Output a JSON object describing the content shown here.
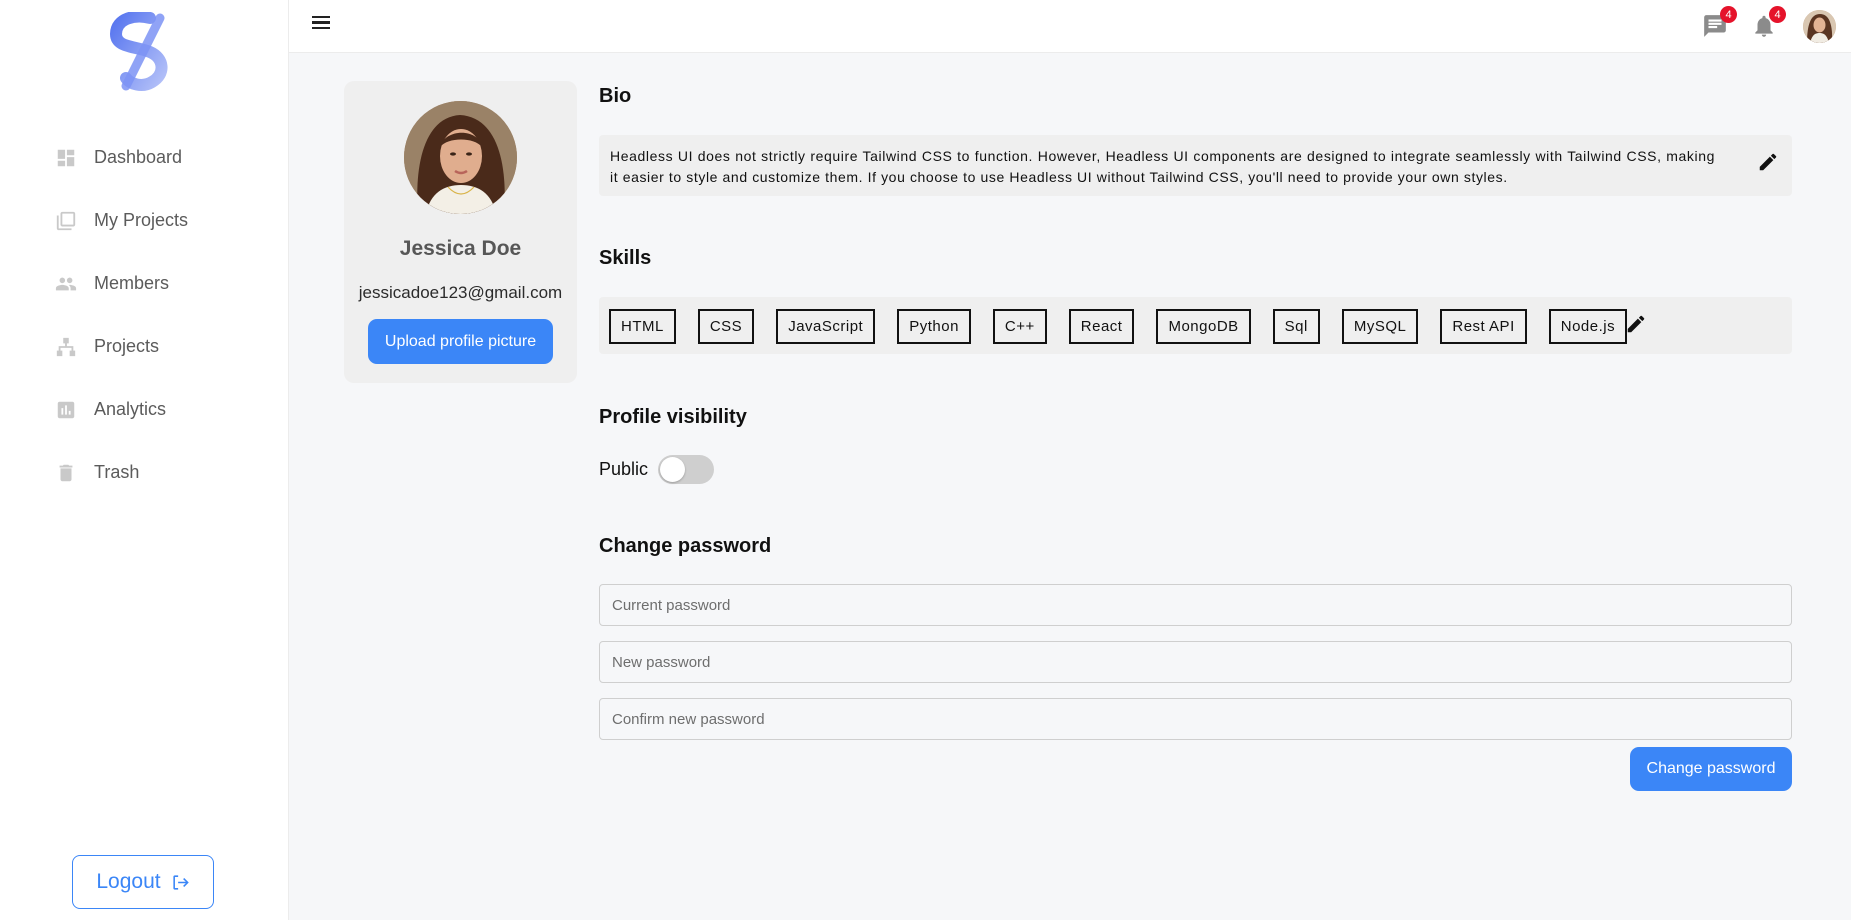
{
  "sidebar": {
    "items": [
      {
        "label": "Dashboard",
        "icon": "dashboard-icon"
      },
      {
        "label": "My Projects",
        "icon": "projects-stack-icon"
      },
      {
        "label": "Members",
        "icon": "members-icon"
      },
      {
        "label": "Projects",
        "icon": "sitemap-icon"
      },
      {
        "label": "Analytics",
        "icon": "analytics-icon"
      },
      {
        "label": "Trash",
        "icon": "trash-icon"
      }
    ],
    "logout_label": "Logout"
  },
  "topbar": {
    "messages_count": "4",
    "notifications_count": "4"
  },
  "profile": {
    "name": "Jessica Doe",
    "email": "jessicadoe123@gmail.com",
    "upload_label": "Upload profile picture"
  },
  "bio": {
    "title": "Bio",
    "text": "Headless UI does not strictly require Tailwind CSS to function. However, Headless UI components are designed to integrate seamlessly with Tailwind CSS, making it easier to style and customize them. If you choose to use Headless UI without Tailwind CSS, you'll need to provide your own styles."
  },
  "skills": {
    "title": "Skills",
    "items": [
      "HTML",
      "CSS",
      "JavaScript",
      "Python",
      "C++",
      "React",
      "MongoDB",
      "Sql",
      "MySQL",
      "Rest API",
      "Node.js"
    ]
  },
  "visibility": {
    "title": "Profile visibility",
    "label": "Public",
    "enabled": false
  },
  "password": {
    "title": "Change password",
    "current_placeholder": "Current password",
    "new_placeholder": "New password",
    "confirm_placeholder": "Confirm new password",
    "button_label": "Change password"
  },
  "colors": {
    "accent": "#3b86f7",
    "badge": "#e5132b",
    "logo_gradient_start": "#5b7cf0",
    "logo_gradient_end": "#a9b9f7"
  }
}
